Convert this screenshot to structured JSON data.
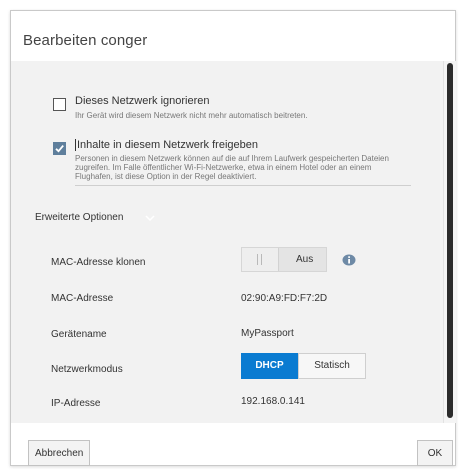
{
  "dialog": {
    "title": "Bearbeiten conger"
  },
  "options": {
    "ignore": {
      "checked": false,
      "title": "Dieses Netzwerk ignorieren",
      "desc": "Ihr Gerät wird diesem Netzwerk nicht mehr automatisch beitreten."
    },
    "share": {
      "checked": true,
      "title": "Inhalte in diesem Netzwerk freigeben",
      "desc_lines": [
        "Personen in diesem Netzwerk können auf die auf Ihrem Laufwerk gespeicherten Dateien",
        "zugreifen. Im Falle öffentlicher Wi-Fi-Netzwerke, etwa in einem Hotel oder an einem",
        "Flughafen, ist diese Option in der Regel deaktiviert."
      ]
    }
  },
  "advanced": {
    "heading": "Erweiterte Optionen",
    "mac_clone": {
      "label": "MAC-Adresse klonen",
      "toggle_state": "Aus"
    },
    "mac_address": {
      "label": "MAC-Adresse",
      "value": "02:90:A9:FD:F7:2D"
    },
    "device_name": {
      "label": "Gerätename",
      "value": "MyPassport"
    },
    "network_mode": {
      "label": "Netzwerkmodus",
      "options": [
        "DHCP",
        "Statisch"
      ],
      "selected": "DHCP"
    },
    "ip_address": {
      "label": "IP-Adresse",
      "value": "192.168.0.141"
    }
  },
  "footer": {
    "cancel_label": "Abbrechen",
    "ok_label": "OK"
  },
  "colors": {
    "accent": "#0a7bd1",
    "checkbox_checked": "#5f7f9c",
    "info_icon": "#6e8aa6"
  }
}
